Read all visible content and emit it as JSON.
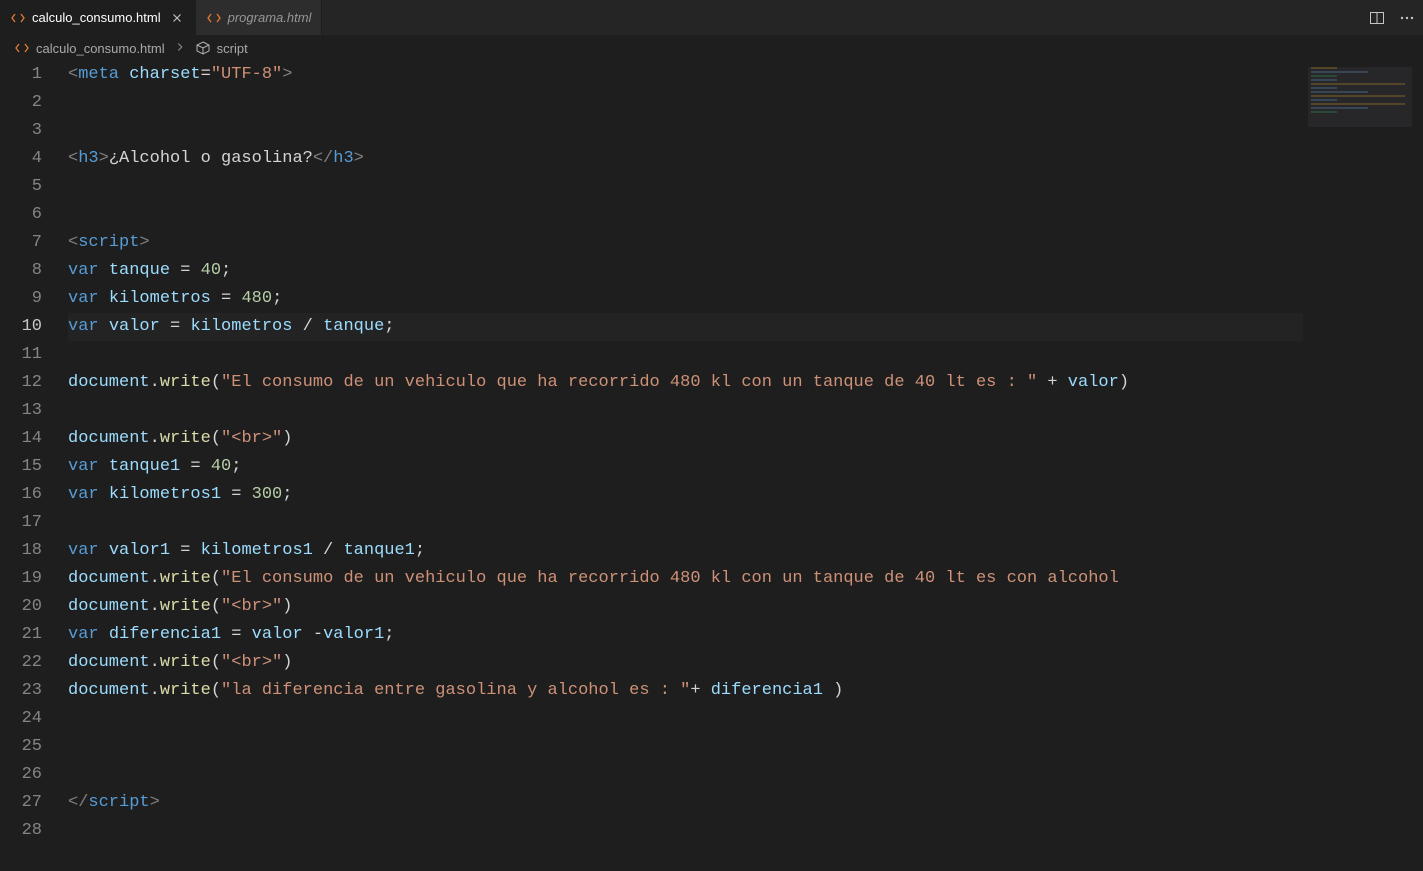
{
  "tabs": [
    {
      "label": "calculo_consumo.html",
      "active": true,
      "italic": false
    },
    {
      "label": "programa.html",
      "active": false,
      "italic": true
    }
  ],
  "breadcrumbs": {
    "file": "calculo_consumo.html",
    "symbol": "script"
  },
  "currentLine": 10,
  "code": [
    {
      "n": 1,
      "tokens": [
        {
          "t": "<",
          "c": "tg"
        },
        {
          "t": "meta",
          "c": "nm"
        },
        {
          "t": " ",
          "c": "op"
        },
        {
          "t": "charset",
          "c": "at"
        },
        {
          "t": "=",
          "c": "op"
        },
        {
          "t": "\"UTF-8\"",
          "c": "st"
        },
        {
          "t": ">",
          "c": "tg"
        }
      ]
    },
    {
      "n": 2,
      "tokens": []
    },
    {
      "n": 3,
      "tokens": []
    },
    {
      "n": 4,
      "tokens": [
        {
          "t": "<",
          "c": "tg"
        },
        {
          "t": "h3",
          "c": "nm"
        },
        {
          "t": ">",
          "c": "tg"
        },
        {
          "t": "¿Alcohol o gasolina?",
          "c": "tx"
        },
        {
          "t": "</",
          "c": "tg"
        },
        {
          "t": "h3",
          "c": "nm"
        },
        {
          "t": ">",
          "c": "tg"
        }
      ]
    },
    {
      "n": 5,
      "tokens": []
    },
    {
      "n": 6,
      "tokens": []
    },
    {
      "n": 7,
      "tokens": [
        {
          "t": "<",
          "c": "tg"
        },
        {
          "t": "script",
          "c": "nm"
        },
        {
          "t": ">",
          "c": "tg"
        }
      ]
    },
    {
      "n": 8,
      "tokens": [
        {
          "t": "var",
          "c": "nm"
        },
        {
          "t": " ",
          "c": "op"
        },
        {
          "t": "tanque",
          "c": "at"
        },
        {
          "t": " = ",
          "c": "op"
        },
        {
          "t": "40",
          "c": "nu"
        },
        {
          "t": ";",
          "c": "op"
        }
      ]
    },
    {
      "n": 9,
      "tokens": [
        {
          "t": "var",
          "c": "nm"
        },
        {
          "t": " ",
          "c": "op"
        },
        {
          "t": "kilometros",
          "c": "at"
        },
        {
          "t": " = ",
          "c": "op"
        },
        {
          "t": "480",
          "c": "nu"
        },
        {
          "t": ";",
          "c": "op"
        }
      ]
    },
    {
      "n": 10,
      "tokens": [
        {
          "t": "var",
          "c": "nm"
        },
        {
          "t": " ",
          "c": "op"
        },
        {
          "t": "valor",
          "c": "at"
        },
        {
          "t": " = ",
          "c": "op"
        },
        {
          "t": "kilometros",
          "c": "at"
        },
        {
          "t": " / ",
          "c": "op"
        },
        {
          "t": "tanque",
          "c": "at"
        },
        {
          "t": ";",
          "c": "op"
        }
      ]
    },
    {
      "n": 11,
      "tokens": []
    },
    {
      "n": 12,
      "tokens": [
        {
          "t": "document",
          "c": "at"
        },
        {
          "t": ".",
          "c": "op"
        },
        {
          "t": "write",
          "c": "fn"
        },
        {
          "t": "(",
          "c": "op"
        },
        {
          "t": "\"El consumo de un vehiculo que ha recorrido 480 kl con un tanque de 40 lt es : \"",
          "c": "st"
        },
        {
          "t": " + ",
          "c": "op"
        },
        {
          "t": "valor",
          "c": "at"
        },
        {
          "t": ")",
          "c": "op"
        }
      ]
    },
    {
      "n": 13,
      "tokens": []
    },
    {
      "n": 14,
      "tokens": [
        {
          "t": "document",
          "c": "at"
        },
        {
          "t": ".",
          "c": "op"
        },
        {
          "t": "write",
          "c": "fn"
        },
        {
          "t": "(",
          "c": "op"
        },
        {
          "t": "\"<br>\"",
          "c": "st"
        },
        {
          "t": ")",
          "c": "op"
        }
      ]
    },
    {
      "n": 15,
      "tokens": [
        {
          "t": "var",
          "c": "nm"
        },
        {
          "t": " ",
          "c": "op"
        },
        {
          "t": "tanque1",
          "c": "at"
        },
        {
          "t": " = ",
          "c": "op"
        },
        {
          "t": "40",
          "c": "nu"
        },
        {
          "t": ";",
          "c": "op"
        }
      ]
    },
    {
      "n": 16,
      "tokens": [
        {
          "t": "var",
          "c": "nm"
        },
        {
          "t": " ",
          "c": "op"
        },
        {
          "t": "kilometros1",
          "c": "at"
        },
        {
          "t": " = ",
          "c": "op"
        },
        {
          "t": "300",
          "c": "nu"
        },
        {
          "t": ";",
          "c": "op"
        }
      ]
    },
    {
      "n": 17,
      "tokens": []
    },
    {
      "n": 18,
      "tokens": [
        {
          "t": "var",
          "c": "nm"
        },
        {
          "t": " ",
          "c": "op"
        },
        {
          "t": "valor1",
          "c": "at"
        },
        {
          "t": " = ",
          "c": "op"
        },
        {
          "t": "kilometros1",
          "c": "at"
        },
        {
          "t": " / ",
          "c": "op"
        },
        {
          "t": "tanque1",
          "c": "at"
        },
        {
          "t": ";",
          "c": "op"
        }
      ]
    },
    {
      "n": 19,
      "tokens": [
        {
          "t": "document",
          "c": "at"
        },
        {
          "t": ".",
          "c": "op"
        },
        {
          "t": "write",
          "c": "fn"
        },
        {
          "t": "(",
          "c": "op"
        },
        {
          "t": "\"El consumo de un vehiculo que ha recorrido 480 kl con un tanque de 40 lt es con alcohol ",
          "c": "st"
        }
      ]
    },
    {
      "n": 20,
      "tokens": [
        {
          "t": "document",
          "c": "at"
        },
        {
          "t": ".",
          "c": "op"
        },
        {
          "t": "write",
          "c": "fn"
        },
        {
          "t": "(",
          "c": "op"
        },
        {
          "t": "\"<br>\"",
          "c": "st"
        },
        {
          "t": ")",
          "c": "op"
        }
      ]
    },
    {
      "n": 21,
      "tokens": [
        {
          "t": "var",
          "c": "nm"
        },
        {
          "t": " ",
          "c": "op"
        },
        {
          "t": "diferencia1",
          "c": "at"
        },
        {
          "t": " = ",
          "c": "op"
        },
        {
          "t": "valor",
          "c": "at"
        },
        {
          "t": " -",
          "c": "op"
        },
        {
          "t": "valor1",
          "c": "at"
        },
        {
          "t": ";",
          "c": "op"
        }
      ]
    },
    {
      "n": 22,
      "tokens": [
        {
          "t": "document",
          "c": "at"
        },
        {
          "t": ".",
          "c": "op"
        },
        {
          "t": "write",
          "c": "fn"
        },
        {
          "t": "(",
          "c": "op"
        },
        {
          "t": "\"<br>\"",
          "c": "st"
        },
        {
          "t": ")",
          "c": "op"
        }
      ]
    },
    {
      "n": 23,
      "tokens": [
        {
          "t": "document",
          "c": "at"
        },
        {
          "t": ".",
          "c": "op"
        },
        {
          "t": "write",
          "c": "fn"
        },
        {
          "t": "(",
          "c": "op"
        },
        {
          "t": "\"la diferencia entre gasolina y alcohol es : \"",
          "c": "st"
        },
        {
          "t": "+ ",
          "c": "op"
        },
        {
          "t": "diferencia1",
          "c": "at"
        },
        {
          "t": " )",
          "c": "op"
        }
      ]
    },
    {
      "n": 24,
      "tokens": []
    },
    {
      "n": 25,
      "tokens": []
    },
    {
      "n": 26,
      "tokens": []
    },
    {
      "n": 27,
      "tokens": [
        {
          "t": "</",
          "c": "tg"
        },
        {
          "t": "script",
          "c": "nm"
        },
        {
          "t": ">",
          "c": "tg"
        }
      ]
    },
    {
      "n": 28,
      "tokens": []
    }
  ]
}
